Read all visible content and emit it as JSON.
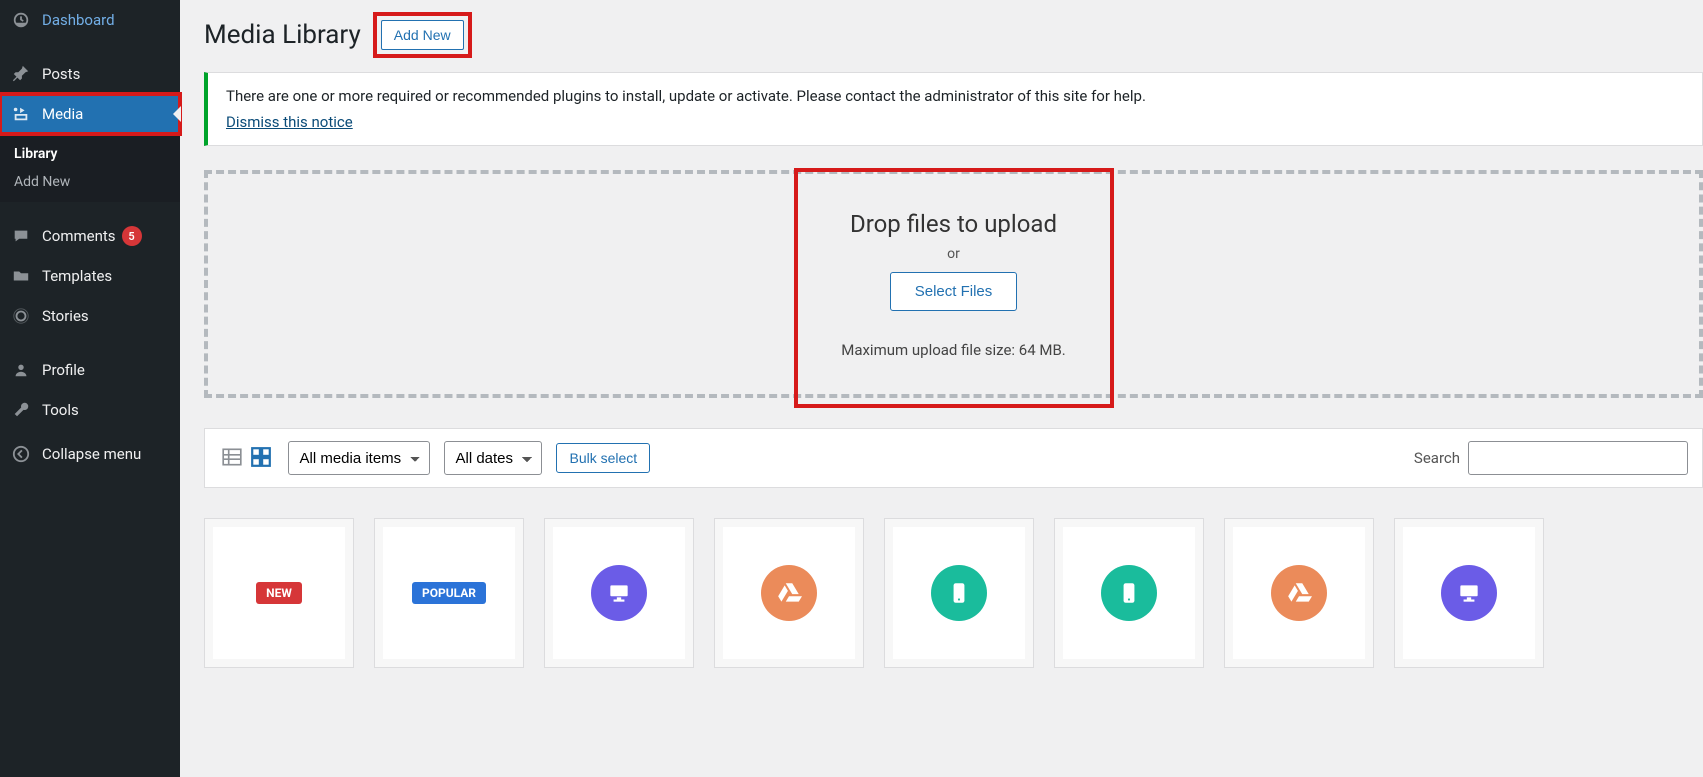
{
  "sidebar": {
    "items": [
      {
        "label": "Dashboard"
      },
      {
        "label": "Posts"
      },
      {
        "label": "Media"
      },
      {
        "label": "Comments",
        "badge": "5"
      },
      {
        "label": "Templates"
      },
      {
        "label": "Stories"
      },
      {
        "label": "Profile"
      },
      {
        "label": "Tools"
      }
    ],
    "submenu": {
      "library": "Library",
      "add_new": "Add New"
    },
    "collapse": "Collapse menu"
  },
  "header": {
    "title": "Media Library",
    "add_new": "Add New"
  },
  "notice": {
    "text": "There are one or more required or recommended plugins to install, update or activate. Please contact the administrator of this site for help.",
    "dismiss": "Dismiss this notice"
  },
  "dropzone": {
    "heading": "Drop files to upload",
    "or": "or",
    "select": "Select Files",
    "max": "Maximum upload file size: 64 MB."
  },
  "filters": {
    "media_items": "All media items",
    "dates": "All dates",
    "bulk": "Bulk select",
    "search_label": "Search",
    "search_value": ""
  },
  "thumbs": {
    "new": "NEW",
    "popular": "POPULAR"
  }
}
